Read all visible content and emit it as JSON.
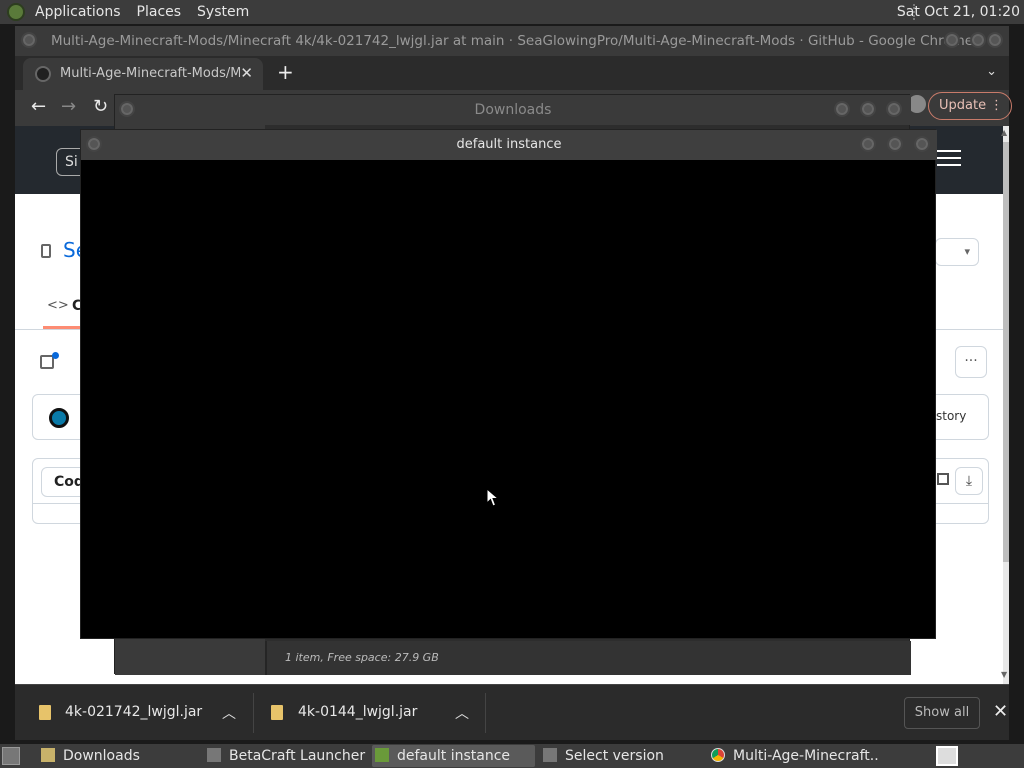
{
  "top_panel": {
    "menus": [
      "Applications",
      "Places",
      "System"
    ],
    "clock": "Sat Oct 21, 01:20"
  },
  "chrome": {
    "window_title": "Multi-Age-Minecraft-Mods/Minecraft 4k/4k-021742_lwjgl.jar at main · SeaGlowingPro/Multi-Age-Minecraft-Mods · GitHub - Google Chrome",
    "tab_title": "Multi-Age-Minecraft-Mods/Mi",
    "update_label": "Update",
    "github": {
      "signin_label": "Si",
      "repo_fragment": "Se",
      "code_tab_fragment": "C",
      "code_button": "Cod",
      "history_fragment": "story"
    }
  },
  "downloads_window": {
    "title": "Downloads",
    "status": "1 item, Free space: 27.9 GB"
  },
  "instance_window": {
    "title": "default instance"
  },
  "downloads_bar": {
    "items": [
      {
        "name": "4k-021742_lwjgl.jar"
      },
      {
        "name": "4k-0144_lwjgl.jar"
      }
    ],
    "show_all": "Show all"
  },
  "taskbar": {
    "tasks": [
      {
        "label": "Downloads",
        "icon": "folder-icon"
      },
      {
        "label": "BetaCraft Launcher ...",
        "icon": "java-icon"
      },
      {
        "label": "default instance",
        "icon": "minecraft-icon",
        "active": true
      },
      {
        "label": "Select version",
        "icon": "java-icon"
      },
      {
        "label": "Multi-Age-Minecraft...",
        "icon": "chrome-icon"
      }
    ]
  },
  "colors": {
    "panel": "#3c3c3c",
    "update_accent": "#c97b6a",
    "file_icon": "#e7c36a"
  }
}
